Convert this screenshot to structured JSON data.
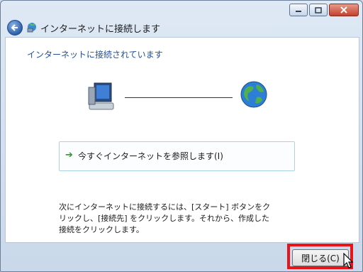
{
  "window": {
    "title": "インターネットに接続します"
  },
  "main": {
    "heading": "インターネットに接続されています",
    "browse_link": "今すぐインターネットを参照します(I)",
    "description": "次にインターネットに接続するには、[スタート] ボタンをクリックし、[接続先] をクリックします。それから、作成した接続をクリックします。"
  },
  "footer": {
    "close_label": "閉じる(C)"
  },
  "colors": {
    "heading": "#1f4fa0",
    "highlight": "#e8141a",
    "link_arrow": "#2a9a2a"
  }
}
